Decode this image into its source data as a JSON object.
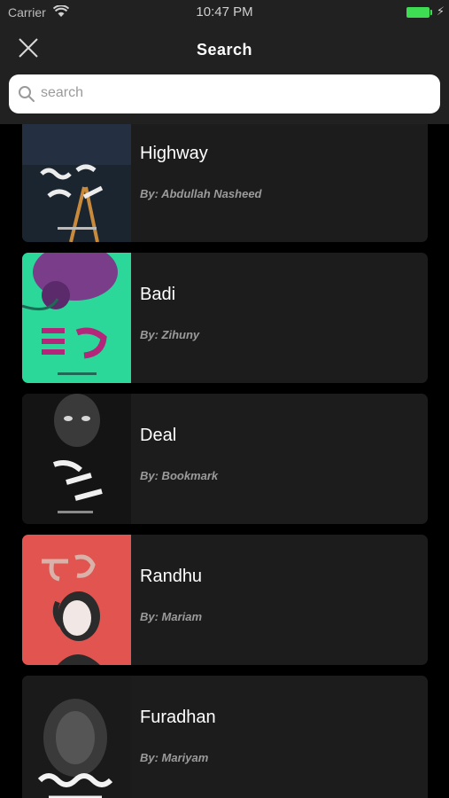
{
  "status_bar": {
    "carrier": "Carrier",
    "time": "10:47 PM",
    "icons": [
      "wifi-icon",
      "battery-icon",
      "charge-icon"
    ],
    "battery_color": "#3ddc52"
  },
  "nav": {
    "title": "Search",
    "close_icon": "close-icon"
  },
  "search": {
    "placeholder": "search",
    "value": "",
    "icon": "search-icon"
  },
  "books": [
    {
      "title": "Highway",
      "author": "By: Abdullah Nasheed",
      "cover_color": "#1b2530"
    },
    {
      "title": "Badi",
      "author": "By: Zihuny",
      "cover_color": "#2bd89a"
    },
    {
      "title": "Deal",
      "author": "By: Bookmark",
      "cover_color": "#141414"
    },
    {
      "title": "Randhu",
      "author": "By: Mariam",
      "cover_color": "#e2544f"
    },
    {
      "title": "Furadhan",
      "author": "By: Mariyam",
      "cover_color": "#1a1a1a"
    }
  ],
  "colors": {
    "background": "#000000",
    "bar": "#212121",
    "card": "#1c1c1c",
    "author_text": "#9b9b9b"
  }
}
